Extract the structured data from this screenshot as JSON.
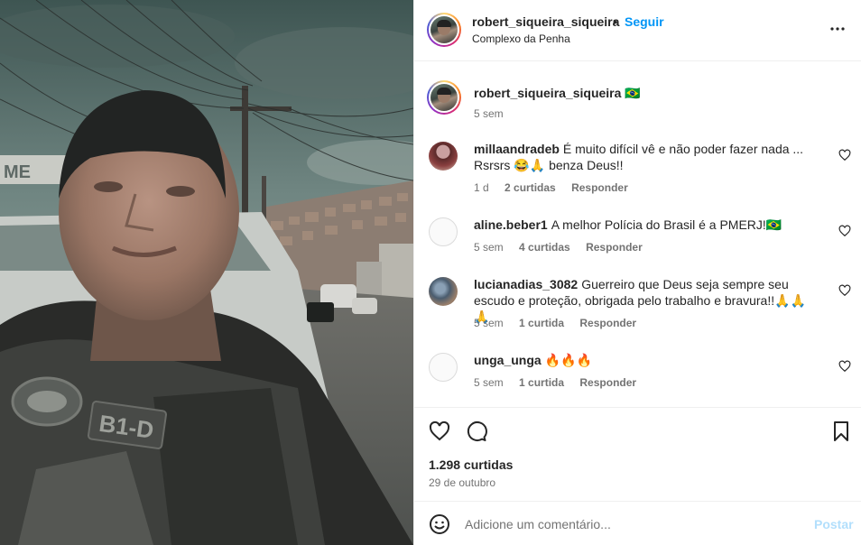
{
  "post": {
    "username": "robert_siqueira_siqueira",
    "separator": "•",
    "follow_label": "Seguir",
    "location": "Complexo da Penha",
    "likes": "1.298 curtidas",
    "date": "29 de outubro"
  },
  "photo": {
    "vest_patch": "B1-D",
    "sign_text": "ME"
  },
  "caption": {
    "username": "robert_siqueira_siqueira",
    "text": "🇧🇷",
    "time": "5 sem"
  },
  "comments": [
    {
      "username": "millaandradeb",
      "text": "É muito difícil vê e não poder fazer nada ... Rsrsrs 😂🙏 benza Deus!!",
      "time": "1 d",
      "likes": "2 curtidas",
      "reply": "Responder"
    },
    {
      "username": "aline.beber1",
      "text": "A melhor Polícia do Brasil é a PMERJ!🇧🇷",
      "time": "5 sem",
      "likes": "4 curtidas",
      "reply": "Responder"
    },
    {
      "username": "lucianadias_3082",
      "text": "Guerreiro que Deus seja sempre seu escudo e proteção, obrigada pelo trabalho e bravura!!🙏🙏🙏",
      "time": "5 sem",
      "likes": "1 curtida",
      "reply": "Responder"
    },
    {
      "username": "unga_unga",
      "text": "🔥🔥🔥",
      "time": "5 sem",
      "likes": "1 curtida",
      "reply": "Responder"
    }
  ],
  "add_comment": {
    "placeholder": "Adicione um comentário...",
    "post_label": "Postar"
  },
  "icons": {
    "more": "more-options-icon",
    "like": "heart-icon",
    "comment": "comment-icon",
    "save": "bookmark-icon",
    "emoji": "emoji-icon"
  },
  "colors": {
    "link": "#0095f6",
    "post_disabled": "#b2dffc",
    "secondary_text": "#737373",
    "divider": "#efefef"
  }
}
